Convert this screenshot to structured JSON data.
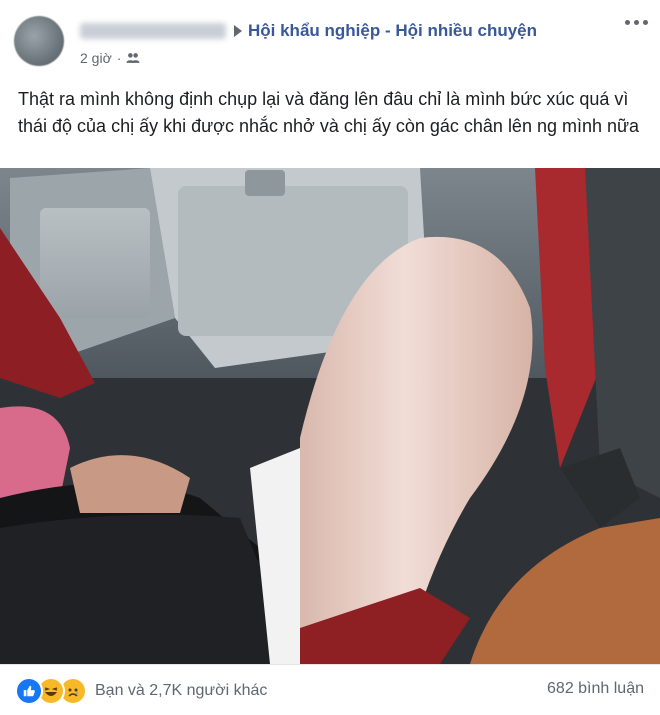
{
  "post": {
    "author_name": "",
    "group_name": "Hội khẩu nghiệp - Hội nhiều chuyện",
    "time": "2 giờ",
    "privacy_icon": "group-icon",
    "menu_icon": "more-options-icon",
    "text": "Thật ra mình không định chụp lại và đăng lên đâu chỉ là mình bức xúc quá vì thái độ của chị ấy khi được nhắc nhở và chị ấy còn gác chân lên ng mình nữa"
  },
  "photo": {
    "description_icon": "airplane-seat-photo"
  },
  "footer": {
    "reaction_icons": [
      "like-icon",
      "haha-icon",
      "sad-icon"
    ],
    "reactions_text": "Bạn và 2,7K người khác",
    "comments_text": "682 bình luận"
  },
  "colors": {
    "link": "#385898",
    "secondary_text": "#606770",
    "like_blue": "#1877f2",
    "emoji_yellow": "#f7b928"
  }
}
